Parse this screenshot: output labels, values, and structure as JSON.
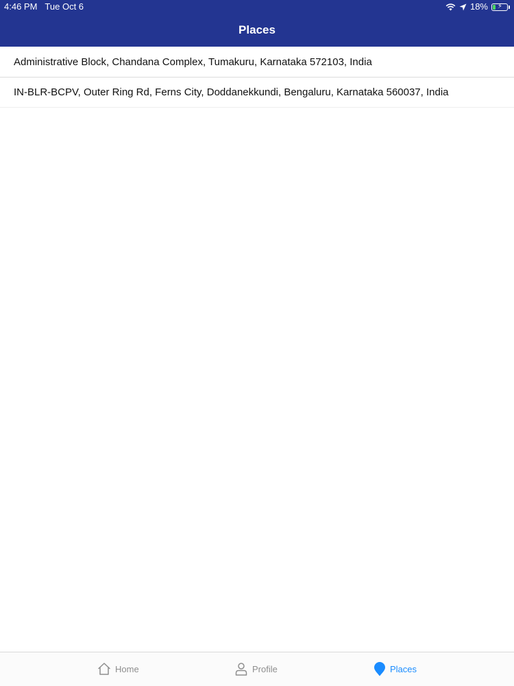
{
  "colors": {
    "header_bg": "#233591",
    "accent": "#1a8cff",
    "inactive": "#8e8e8e",
    "battery_fill": "#4cd964"
  },
  "status_bar": {
    "time": "4:46 PM",
    "date": "Tue Oct 6",
    "battery_percent": "18%",
    "icons": [
      "wifi-icon",
      "location-arrow-icon",
      "battery-charging-icon"
    ]
  },
  "header": {
    "title": "Places"
  },
  "places": [
    {
      "address": "Administrative Block, Chandana Complex, Tumakuru, Karnataka 572103, India"
    },
    {
      "address": "IN-BLR-BCPV, Outer Ring Rd, Ferns City, Doddanekkundi, Bengaluru, Karnataka 560037, India"
    }
  ],
  "tabbar": {
    "tabs": [
      {
        "label": "Home",
        "icon": "home-icon",
        "active": false
      },
      {
        "label": "Profile",
        "icon": "person-icon",
        "active": false
      },
      {
        "label": "Places",
        "icon": "map-pin-icon",
        "active": true
      }
    ]
  }
}
